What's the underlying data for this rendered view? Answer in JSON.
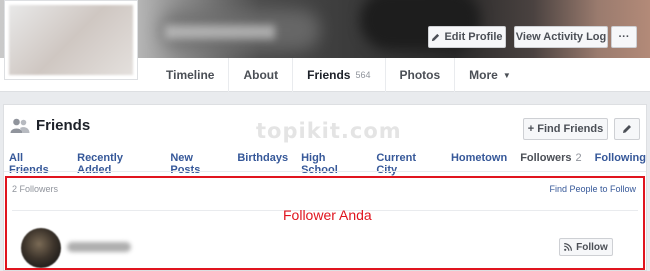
{
  "profile": {
    "buttons": {
      "edit_profile": "Edit Profile",
      "activity_log": "View Activity Log",
      "more": "···"
    },
    "tabs": [
      {
        "label": "Timeline"
      },
      {
        "label": "About"
      },
      {
        "label": "Friends",
        "count": "564"
      },
      {
        "label": "Photos"
      },
      {
        "label": "More"
      }
    ]
  },
  "friends": {
    "title": "Friends",
    "watermark": "topikit.com",
    "find_friends": "+ Find Friends",
    "subtabs": [
      {
        "label": "All Friends"
      },
      {
        "label": "Recently Added"
      },
      {
        "label": "New Posts"
      },
      {
        "label": "Birthdays"
      },
      {
        "label": "High School"
      },
      {
        "label": "Current City"
      },
      {
        "label": "Hometown"
      },
      {
        "label": "Followers",
        "count": "2",
        "active": true
      },
      {
        "label": "Following"
      }
    ],
    "followers_count": "2 Followers",
    "find_people": "Find People to Follow",
    "annotation": "Follower Anda",
    "follow_button": "Follow"
  },
  "colors": {
    "link": "#365899",
    "highlight": "#e0141e",
    "text": "#4b4f56"
  },
  "icons": [
    "pencil-icon",
    "friends-icon",
    "caret-down-icon",
    "rss-icon"
  ]
}
